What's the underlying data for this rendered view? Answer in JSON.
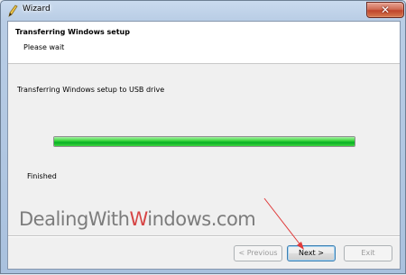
{
  "window": {
    "title": "Wizard",
    "close_symbol": "✕"
  },
  "header": {
    "title": "Transferring Windows setup",
    "subtitle": "Please wait"
  },
  "main": {
    "status_text": "Transferring Windows setup to USB drive",
    "progress_percent": 100,
    "finished_text": "Finished"
  },
  "watermark": {
    "part1": "Dealing",
    "part2": "With",
    "accent": "W",
    "part3": "indows.com"
  },
  "buttons": {
    "previous": "< Previous",
    "next": "Next >",
    "exit": "Exit"
  },
  "colors": {
    "progress_green": "#06b025",
    "annotation_arrow": "#e03a3a"
  },
  "icons": {
    "app": "pencil-icon",
    "close": "close-icon"
  }
}
